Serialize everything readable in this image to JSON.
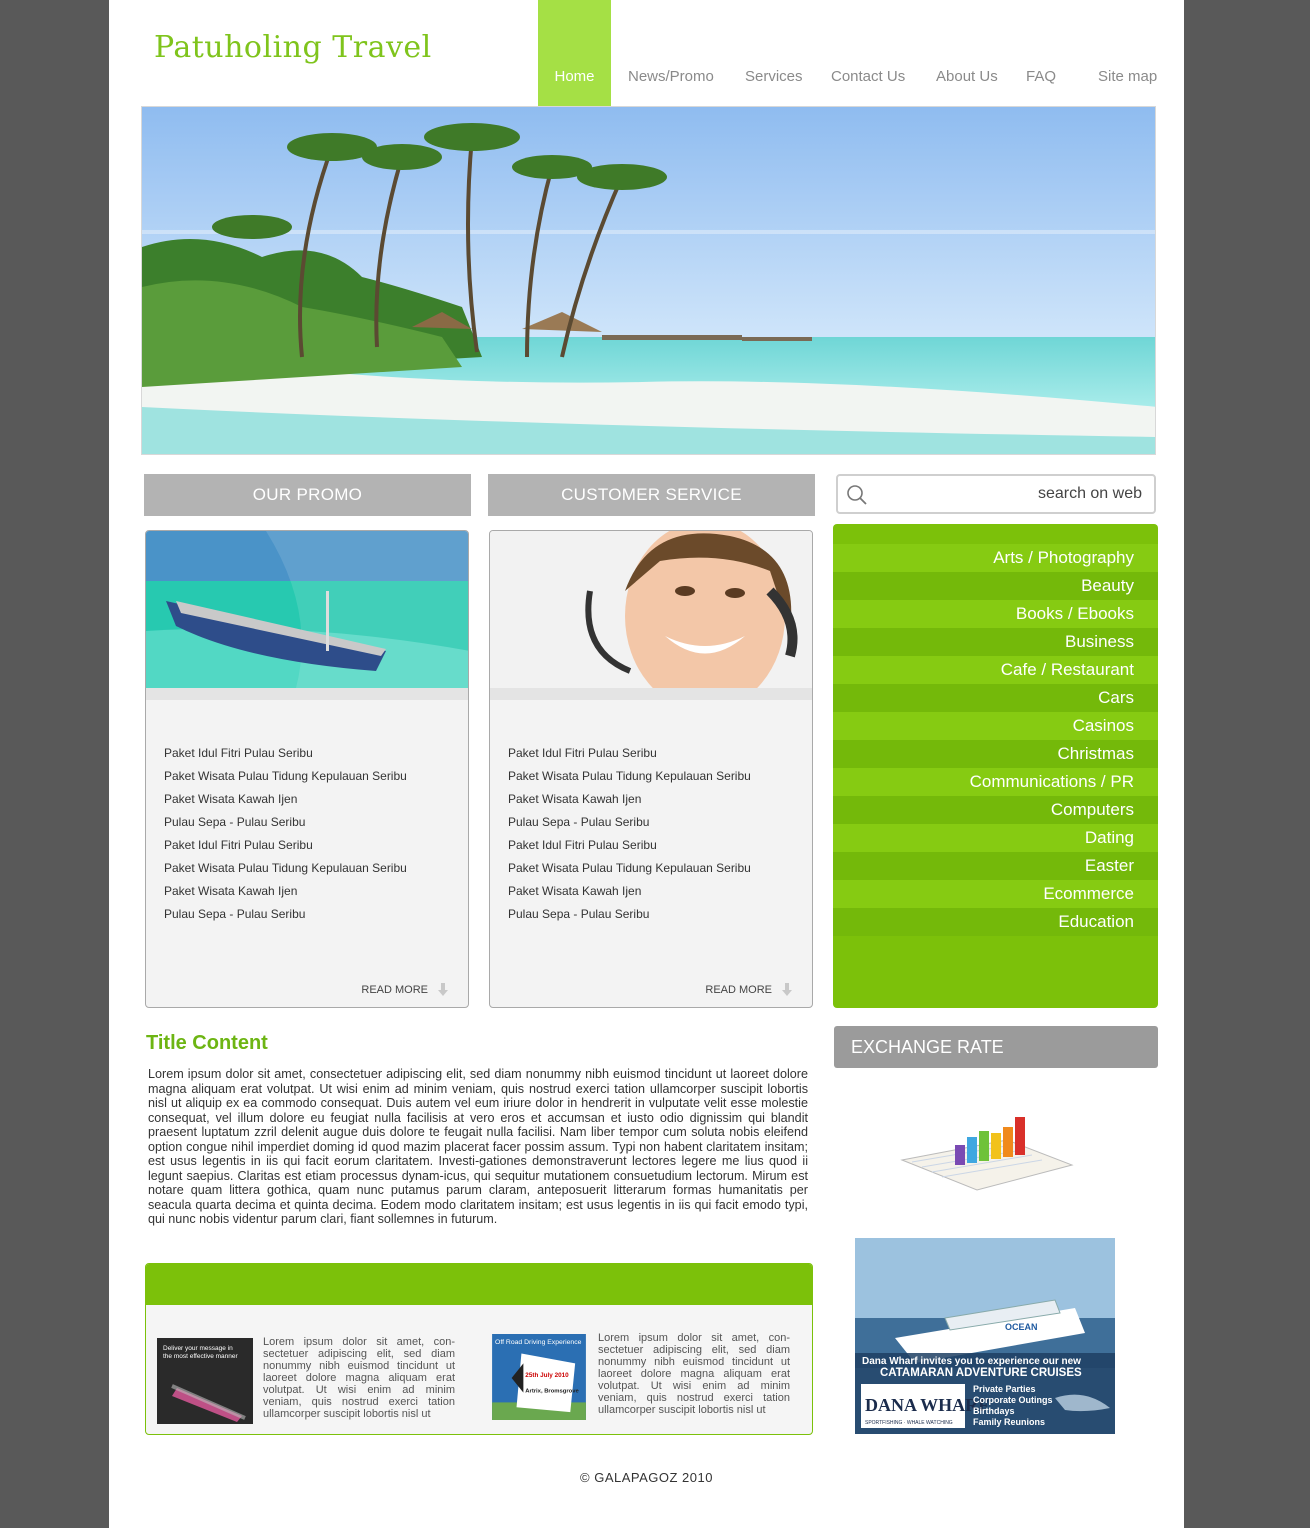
{
  "site": {
    "logo": "Patuholing Travel",
    "accent_color": "#7cc10a",
    "nav_highlight_color": "#a5e045"
  },
  "nav": {
    "home": "Home",
    "news": "News/Promo",
    "services": "Services",
    "contact": "Contact Us",
    "about": "About Us",
    "faq": "FAQ",
    "sitemap": "Site map"
  },
  "promo": {
    "title": "OUR PROMO",
    "items": [
      "Paket Idul Fitri Pulau Seribu",
      "Paket Wisata Pulau Tidung Kepulauan Seribu",
      "Paket Wisata Kawah Ijen",
      "Pulau Sepa - Pulau Seribu",
      "Paket Idul Fitri Pulau Seribu",
      "Paket Wisata Pulau Tidung Kepulauan Seribu",
      "Paket Wisata Kawah Ijen",
      "Pulau Sepa - Pulau Seribu"
    ],
    "read_more": "READ MORE"
  },
  "service": {
    "title": "CUSTOMER SERVICE",
    "items": [
      "Paket Idul Fitri Pulau Seribu",
      "Paket Wisata Pulau Tidung Kepulauan Seribu",
      "Paket Wisata Kawah Ijen",
      "Pulau Sepa - Pulau Seribu",
      "Paket Idul Fitri Pulau Seribu",
      "Paket Wisata Pulau Tidung Kepulauan Seribu",
      "Paket Wisata Kawah Ijen",
      "Pulau Sepa - Pulau Seribu"
    ],
    "read_more": "READ MORE"
  },
  "search": {
    "placeholder": "search on web",
    "icon": "search-icon"
  },
  "categories": [
    "Arts / Photography",
    "Beauty",
    "Books / Ebooks",
    "Business",
    "Cafe / Restaurant",
    "Cars",
    "Casinos",
    "Christmas",
    "Communications / PR",
    "Computers",
    "Dating",
    "Easter",
    "Ecommerce",
    "Education"
  ],
  "exchange": {
    "title": "EXCHANGE RATE"
  },
  "content": {
    "title": "Title Content",
    "body": "Lorem ipsum dolor sit amet, consectetuer adipiscing elit, sed diam nonummy nibh euismod tincidunt ut laoreet dolore magna aliquam erat volutpat. Ut wisi enim ad minim veniam, quis nostrud exerci tation ullamcorper suscipit lobortis nisl ut aliquip ex ea commodo consequat. Duis autem vel eum iriure dolor in hendrerit in vulputate velit esse molestie consequat, vel illum dolore eu feugiat nulla facilisis at vero eros et accumsan et iusto odio dignissim qui blandit praesent luptatum zzril delenit augue duis dolore te feugait nulla facilisi. Nam liber tempor cum soluta nobis eleifend option congue nihil imperdiet doming id quod mazim placerat facer possim assum. Typi non habent claritatem insitam; est usus legentis in iis qui facit eorum claritatem. Investi-gationes demonstraverunt lectores legere me lius quod ii legunt saepius. Claritas est etiam processus dynam-icus, qui sequitur mutationem consuetudium lectorum. Mirum est notare quam littera gothica, quam nunc putamus parum claram, anteposuerit litterarum formas humanitatis per seacula quarta decima et quinta decima. Eodem modo claritatem insitam; est usus legentis in iis qui facit emodo typi, qui nunc nobis videntur parum clari, fiant sollemnes in futurum."
  },
  "news": {
    "item1_text": "Lorem ipsum dolor sit amet, con-sectetuer adipiscing elit, sed diam nonummy nibh euismod tincidunt ut laoreet dolore magna aliquam erat volutpat. Ut wisi enim ad minim veniam, quis nostrud exerci tation ullamcorper suscipit lobortis nisl ut",
    "item2_text": "Lorem ipsum dolor sit amet, con-sectetuer adipiscing elit, sed diam nonummy nibh euismod tincidunt ut laoreet dolore magna aliquam erat volutpat. Ut wisi enim ad minim veniam, quis nostrud exerci tation ullamcorper suscipit lobortis nisl ut",
    "thumb1_lines": [
      "Deliver your message in",
      "the most effective manner"
    ],
    "thumb2_title": "Off Road Driving Experience",
    "thumb2_date": "25th July 2010",
    "thumb2_place": "Artrix, Bromsgrove"
  },
  "ad": {
    "brand": "OCEAN",
    "invite": "Dana Wharf invites you to experience our new",
    "headline": "CATAMARAN ADVENTURE CRUISES",
    "logo": "DANA WHARF",
    "logo_sub": "SPORTFISHING · WHALE WATCHING",
    "bullets": [
      "Private Parties",
      "Corporate Outings",
      "Birthdays",
      "Family Reunions"
    ]
  },
  "footer": "©  GALAPAGOZ  2010"
}
